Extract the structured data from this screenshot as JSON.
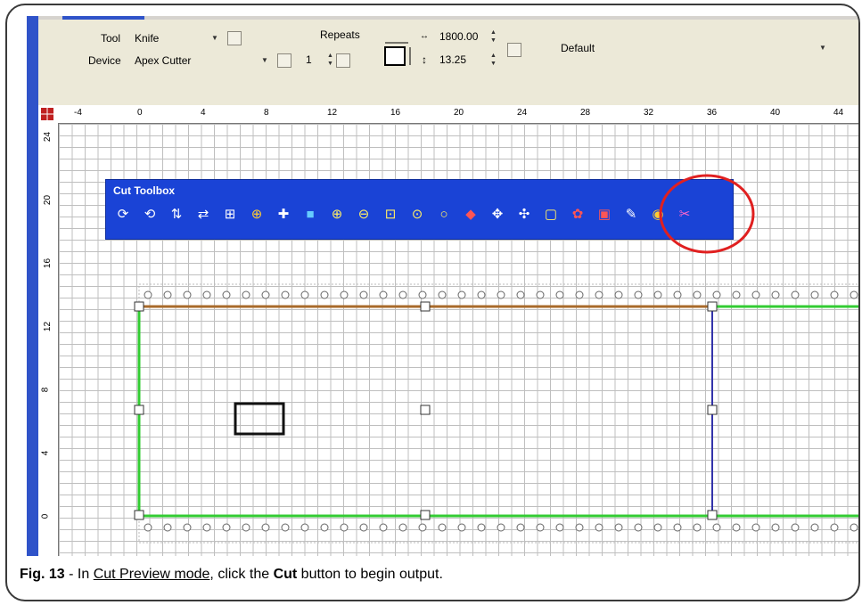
{
  "toolbar": {
    "tool_label": "Tool",
    "tool_value": "Knife",
    "device_label": "Device",
    "device_value": "Apex Cutter",
    "repeats_label": "Repeats",
    "repeats_value": "1",
    "width_value": "1800.00",
    "height_value": "13.25",
    "profile_value": "Default"
  },
  "ruler": {
    "h_labels": [
      "-4",
      "0",
      "4",
      "8",
      "12",
      "16",
      "20",
      "24",
      "28",
      "32",
      "36",
      "40",
      "44"
    ],
    "v_labels": [
      "24",
      "20",
      "16",
      "12",
      "8",
      "4",
      "0"
    ]
  },
  "cut_toolbox": {
    "title": "Cut Toolbox",
    "icons": [
      "redo-icon",
      "undo-icon",
      "flip-icon",
      "mirror-icon",
      "grid-icon",
      "target-icon",
      "crosshair-icon",
      "fill-icon",
      "zoom-in-icon",
      "zoom-out-icon",
      "zoom-fit-icon",
      "zoom-selection-icon",
      "zoom-icon",
      "knife-icon",
      "move-icon",
      "move-points-icon",
      "select-icon",
      "weed-icon",
      "color-icon",
      "pen-icon",
      "lock-icon",
      "cut-icon"
    ]
  },
  "caption": {
    "fig": "Fig. 13",
    "text1": " - In ",
    "mode": "Cut Preview mode",
    "text2": ", click the ",
    "cut": "Cut",
    "text3": " button to begin output."
  },
  "colors": {
    "highlight_circle": "#e02020",
    "green_line": "#33cc33",
    "brown_line": "#a86a2a",
    "blue_line": "#3333aa"
  }
}
